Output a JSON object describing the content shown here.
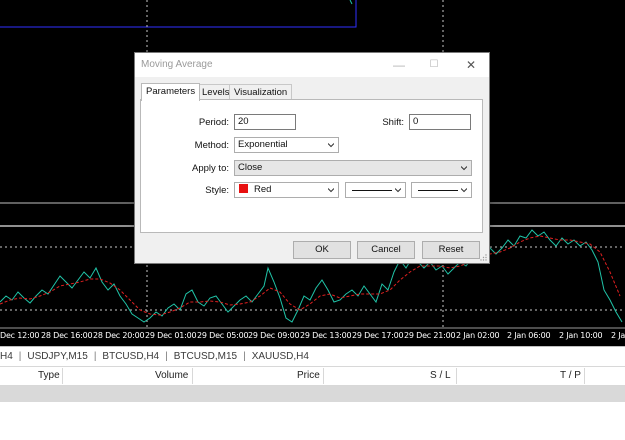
{
  "colors": {
    "chart_bg": "#000000",
    "price_line": "#20c4a8",
    "ma_line": "#e02020",
    "grid": "#c8c8c8",
    "accent_box": "#3030ff",
    "style_color": "#e81010"
  },
  "chart": {
    "time_labels": [
      "Dec 12:00",
      "28 Dec 16:00",
      "28 Dec 20:00",
      "29 Dec 01:00",
      "29 Dec 05:00",
      "29 Dec 09:00",
      "29 Dec 13:00",
      "29 Dec 17:00",
      "29 Dec 21:00",
      "2 Jan 02:00",
      "2 Jan 06:00",
      "2 Jan 10:00",
      "2 Ja"
    ]
  },
  "symbol_tabs": [
    "H4",
    "USDJPY,M15",
    "BTCUSD,H4",
    "BTCUSD,M15",
    "XAUUSD,H4"
  ],
  "trade_table": {
    "columns": [
      "Type",
      "Volume",
      "Price",
      "S / L",
      "T / P"
    ]
  },
  "dialog": {
    "title": "Moving Average",
    "minimize_glyph": "—",
    "maximize_glyph": "☐",
    "close_glyph": "✕",
    "tabs": [
      "Parameters",
      "Levels",
      "Visualization"
    ],
    "active_tab": "Parameters",
    "period_label": "Period:",
    "period_value": "20",
    "shift_label": "Shift:",
    "shift_value": "0",
    "method_label": "Method:",
    "method_value": "Exponential",
    "apply_label": "Apply to:",
    "apply_value": "Close",
    "style_label": "Style:",
    "style_color_name": "Red",
    "ok_label": "OK",
    "cancel_label": "Cancel",
    "reset_label": "Reset"
  }
}
